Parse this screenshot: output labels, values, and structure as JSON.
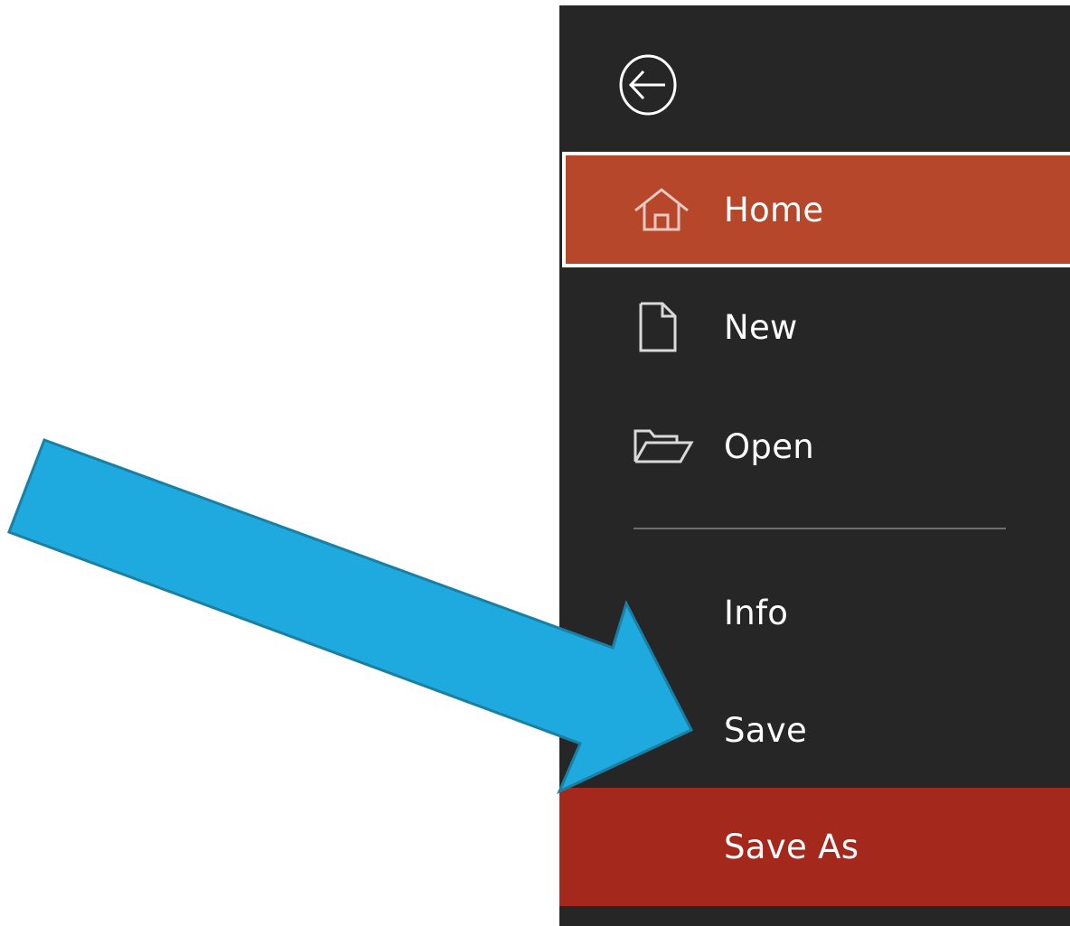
{
  "backstage": {
    "back_icon": "back-arrow-circle-icon",
    "items": [
      {
        "label": "Home",
        "icon": "home-icon",
        "selected": true
      },
      {
        "label": "New",
        "icon": "new-document-icon"
      },
      {
        "label": "Open",
        "icon": "open-folder-icon"
      },
      {
        "label": "Info"
      },
      {
        "label": "Save"
      },
      {
        "label": "Save As",
        "highlighted": true
      }
    ]
  },
  "annotation": {
    "icon": "pointer-arrow-icon",
    "color": "#1eaadf",
    "outline_color": "#1a7fa3"
  },
  "colors": {
    "backstage_bg": "#262626",
    "selected_bg": "#b7472a",
    "highlight_bg": "#a4281b",
    "text": "#ffffff"
  }
}
